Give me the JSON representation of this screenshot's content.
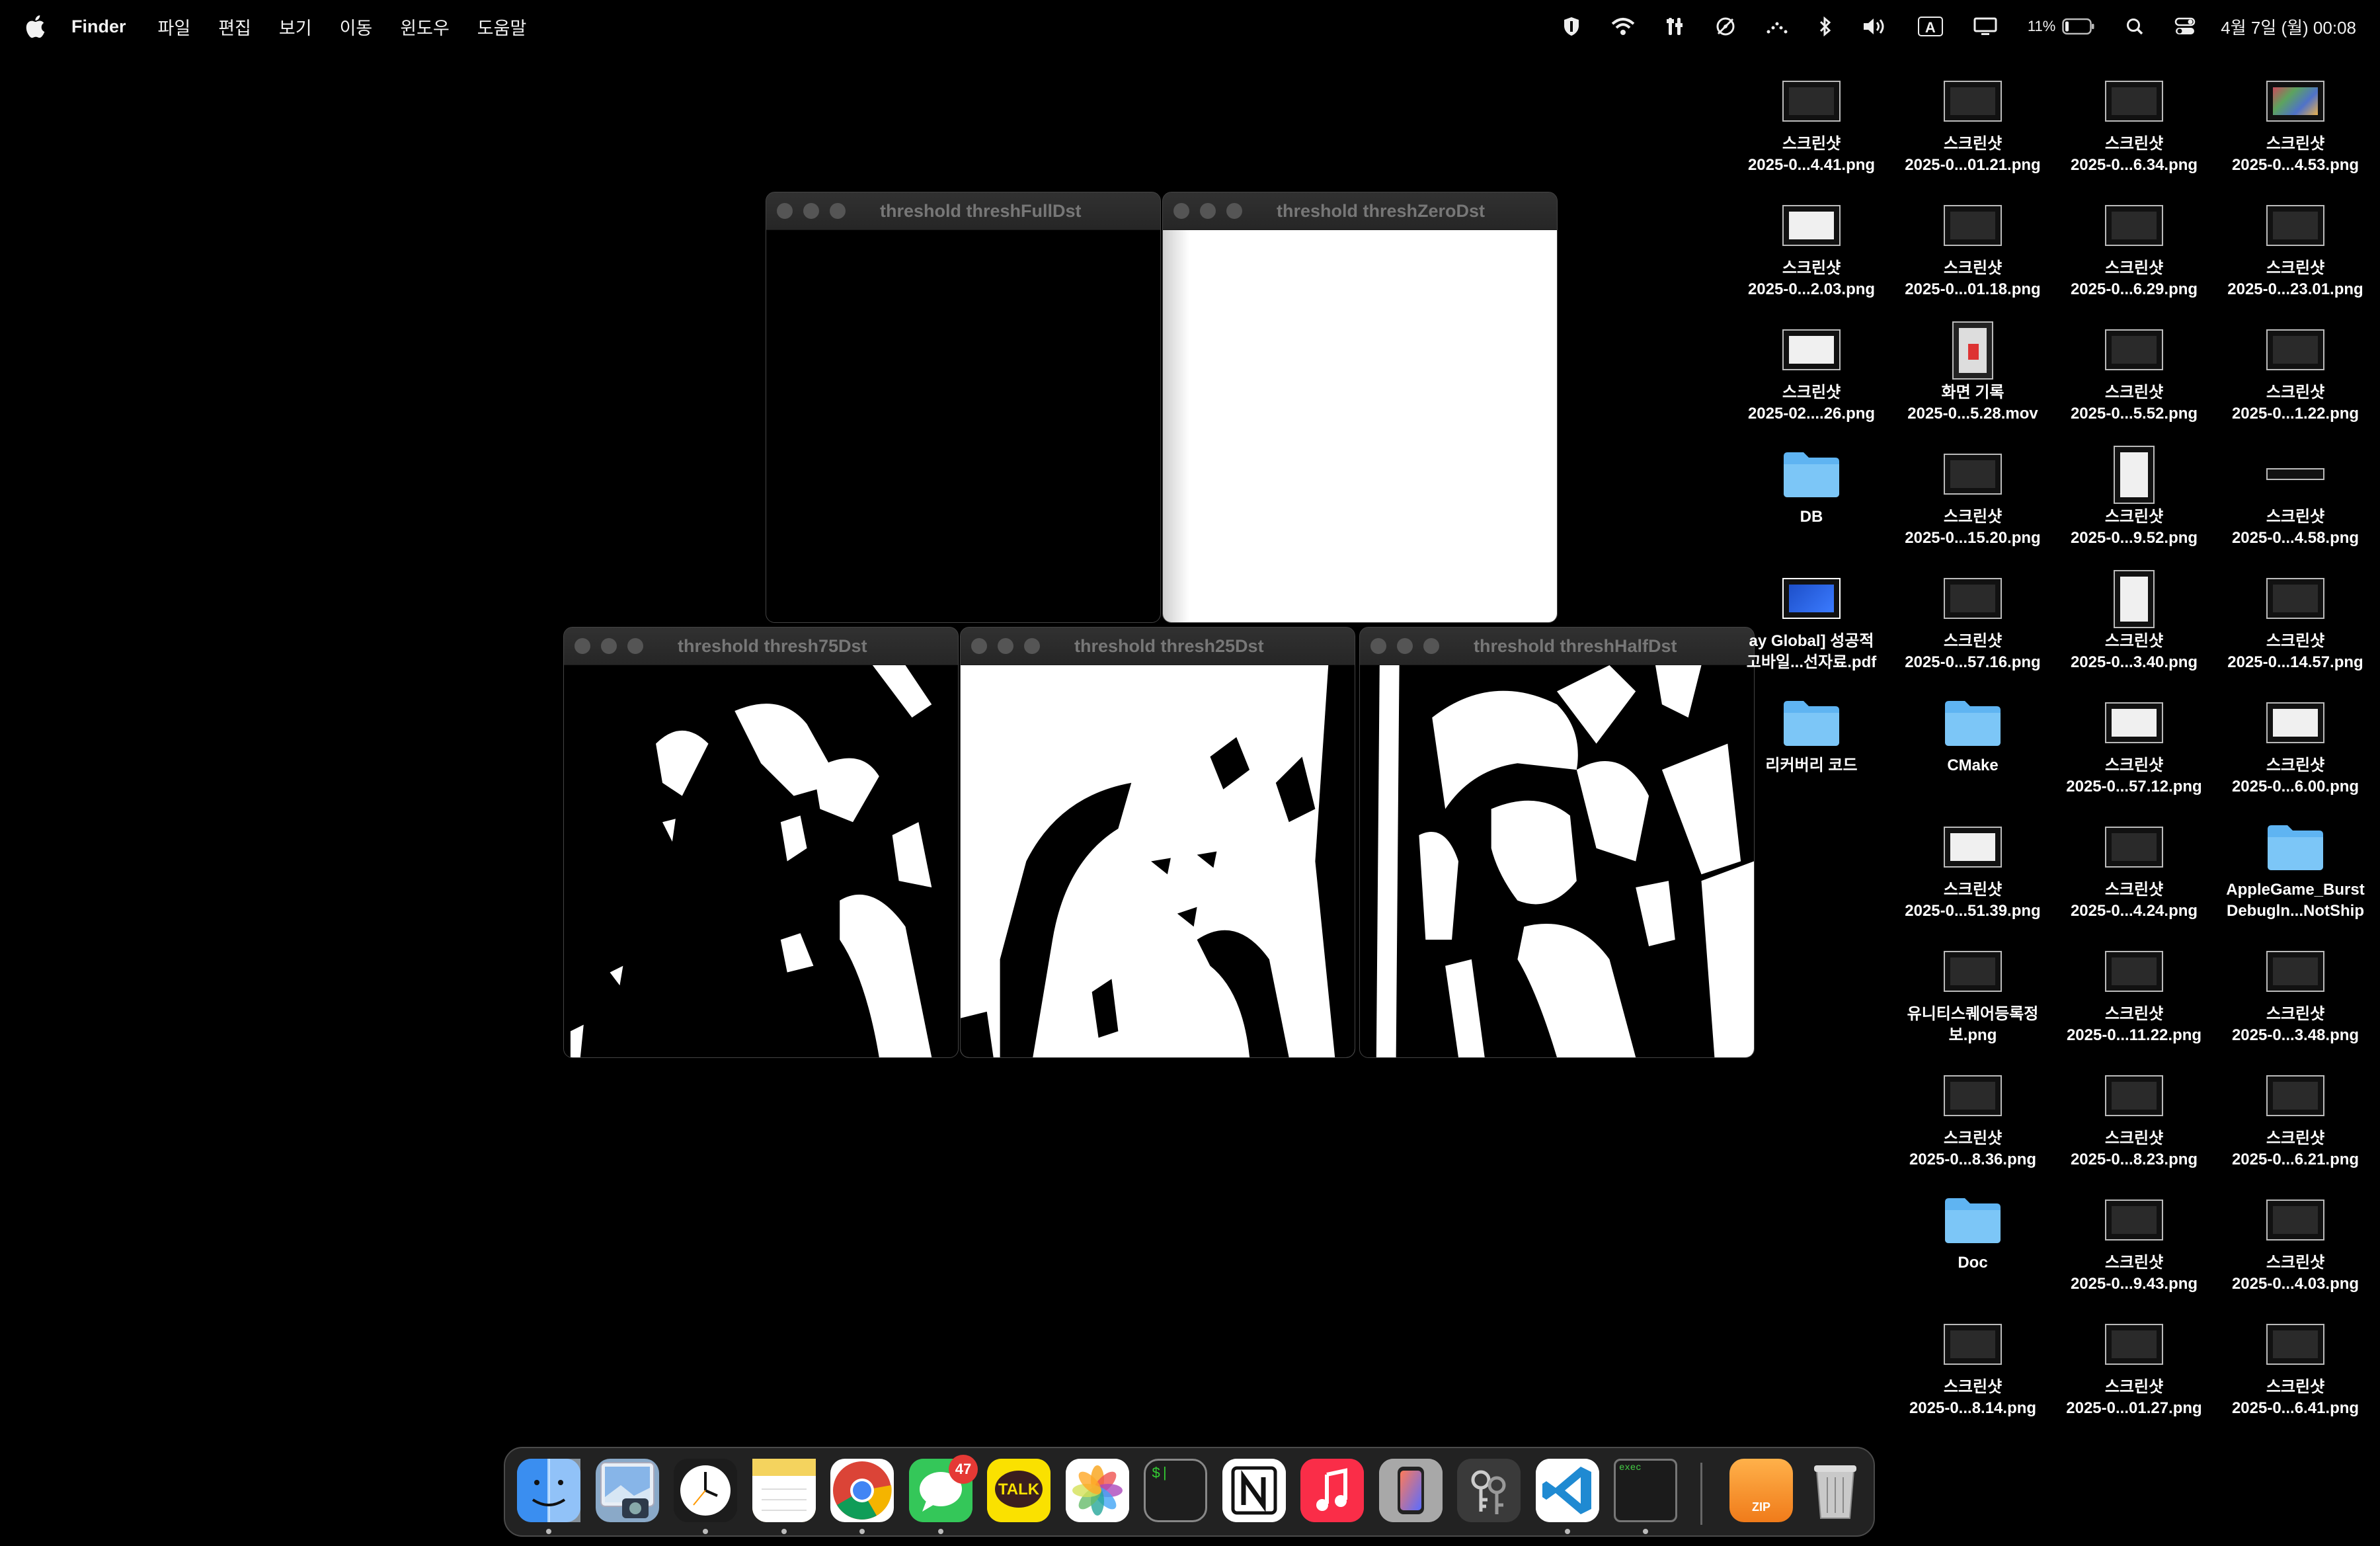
{
  "menubar": {
    "app_name": "Finder",
    "menus": [
      "파일",
      "편집",
      "보기",
      "이동",
      "윈도우",
      "도움말"
    ],
    "input_source": "A",
    "battery_percent": "11%",
    "clock": "4월 7일 (월) 00:08"
  },
  "windows": [
    {
      "title": "threshold threshFullDst"
    },
    {
      "title": "threshold threshZeroDst"
    },
    {
      "title": "threshold thresh75Dst"
    },
    {
      "title": "threshold thresh25Dst"
    },
    {
      "title": "threshold threshHalfDst"
    }
  ],
  "desktop_icons": [
    {
      "line1": "스크린샷",
      "line2": "2025-0...4.41.png",
      "kind": "screenshot"
    },
    {
      "line1": "스크린샷",
      "line2": "2025-0...01.21.png",
      "kind": "screenshot"
    },
    {
      "line1": "스크린샷",
      "line2": "2025-0...6.34.png",
      "kind": "screenshot"
    },
    {
      "line1": "스크린샷",
      "line2": "2025-0...4.53.png",
      "kind": "screenshot-color"
    },
    {
      "line1": "스크린샷",
      "line2": "2025-0...2.03.png",
      "kind": "screenshot-light"
    },
    {
      "line1": "스크린샷",
      "line2": "2025-0...01.18.png",
      "kind": "screenshot"
    },
    {
      "line1": "스크린샷",
      "line2": "2025-0...6.29.png",
      "kind": "screenshot"
    },
    {
      "line1": "스크린샷",
      "line2": "2025-0...23.01.png",
      "kind": "screenshot"
    },
    {
      "line1": "스크린샷",
      "line2": "2025-02....26.png",
      "kind": "screenshot-light"
    },
    {
      "line1": "화면 기록",
      "line2": "2025-0...5.28.mov",
      "kind": "video"
    },
    {
      "line1": "스크린샷",
      "line2": "2025-0...5.52.png",
      "kind": "screenshot"
    },
    {
      "line1": "스크린샷",
      "line2": "2025-0...1.22.png",
      "kind": "screenshot"
    },
    {
      "line1": "DB",
      "line2": "",
      "kind": "folder"
    },
    {
      "line1": "스크린샷",
      "line2": "2025-0...15.20.png",
      "kind": "screenshot"
    },
    {
      "line1": "스크린샷",
      "line2": "2025-0...9.52.png",
      "kind": "screenshot-tall"
    },
    {
      "line1": "스크린샷",
      "line2": "2025-0...4.58.png",
      "kind": "screenshot-strip"
    },
    {
      "line1": "ay Global] 성공적",
      "line2": "고바일...선자료.pdf",
      "kind": "pdf"
    },
    {
      "line1": "스크린샷",
      "line2": "2025-0...57.16.png",
      "kind": "screenshot"
    },
    {
      "line1": "스크린샷",
      "line2": "2025-0...3.40.png",
      "kind": "screenshot-tall"
    },
    {
      "line1": "스크린샷",
      "line2": "2025-0...14.57.png",
      "kind": "screenshot"
    },
    {
      "line1": "리커버리 코드",
      "line2": "",
      "kind": "folder"
    },
    {
      "line1": "CMake",
      "line2": "",
      "kind": "folder"
    },
    {
      "line1": "스크린샷",
      "line2": "2025-0...57.12.png",
      "kind": "screenshot-light"
    },
    {
      "line1": "스크린샷",
      "line2": "2025-0...6.00.png",
      "kind": "screenshot-light"
    },
    {
      "line1": "스크린샷",
      "line2": "2025-0...51.39.png",
      "kind": "screenshot-light"
    },
    {
      "line1": "스크린샷",
      "line2": "2025-0...4.24.png",
      "kind": "screenshot"
    },
    {
      "line1": "AppleGame_Burst",
      "line2": "Debugln...NotShip",
      "kind": "folder"
    },
    {
      "line1": "유니티스퀘어등록정",
      "line2": "보.png",
      "kind": "screenshot"
    },
    {
      "line1": "스크린샷",
      "line2": "2025-0...11.22.png",
      "kind": "screenshot"
    },
    {
      "line1": "스크린샷",
      "line2": "2025-0...3.48.png",
      "kind": "screenshot"
    },
    {
      "line1": "스크린샷",
      "line2": "2025-0...8.36.png",
      "kind": "screenshot"
    },
    {
      "line1": "스크린샷",
      "line2": "2025-0...8.23.png",
      "kind": "screenshot"
    },
    {
      "line1": "스크린샷",
      "line2": "2025-0...6.21.png",
      "kind": "screenshot"
    },
    {
      "line1": "Doc",
      "line2": "",
      "kind": "folder"
    },
    {
      "line1": "스크린샷",
      "line2": "2025-0...9.43.png",
      "kind": "screenshot"
    },
    {
      "line1": "스크린샷",
      "line2": "2025-0...4.03.png",
      "kind": "screenshot"
    },
    {
      "line1": "스크린샷",
      "line2": "2025-0...8.14.png",
      "kind": "screenshot"
    },
    {
      "line1": "스크린샷",
      "line2": "2025-0...01.27.png",
      "kind": "screenshot"
    },
    {
      "line1": "스크린샷",
      "line2": "2025-0...6.41.png",
      "kind": "screenshot"
    }
  ],
  "dock": {
    "apps": [
      {
        "name": "finder-app-icon",
        "color": "#3a8ef0",
        "running": true
      },
      {
        "name": "preview-app-icon",
        "color": "#8aa9c8",
        "running": false
      },
      {
        "name": "clock-app-icon",
        "color": "#1c1c1c",
        "running": true
      },
      {
        "name": "notes-app-icon",
        "color": "#f4d35e",
        "running": true
      },
      {
        "name": "chrome-app-icon",
        "color": "#ffffff",
        "running": true
      },
      {
        "name": "messages-app-icon",
        "color": "#34c759",
        "running": true
      },
      {
        "name": "kakaotalk-app-icon",
        "color": "#fae100",
        "running": false
      },
      {
        "name": "photos-app-icon",
        "color": "#ffffff",
        "running": false
      },
      {
        "name": "terminal-app-icon",
        "color": "#1e1e1e",
        "running": false
      },
      {
        "name": "notion-app-icon",
        "color": "#ffffff",
        "running": false
      },
      {
        "name": "music-app-icon",
        "color": "#fa2d48",
        "running": false
      },
      {
        "name": "iphone-mirroring-app-icon",
        "color": "#b0b0b0",
        "running": false
      },
      {
        "name": "keychain-app-icon",
        "color": "#3a3a3a",
        "running": false
      },
      {
        "name": "vscode-app-icon",
        "color": "#ffffff",
        "running": true
      },
      {
        "name": "exec-app-icon",
        "color": "#1b1b1b",
        "running": true
      }
    ],
    "messages_badge": "47",
    "kakao_label": "TALK",
    "terminal_label": "$|",
    "exec_label": "exec",
    "archive_label": "ZIP"
  }
}
